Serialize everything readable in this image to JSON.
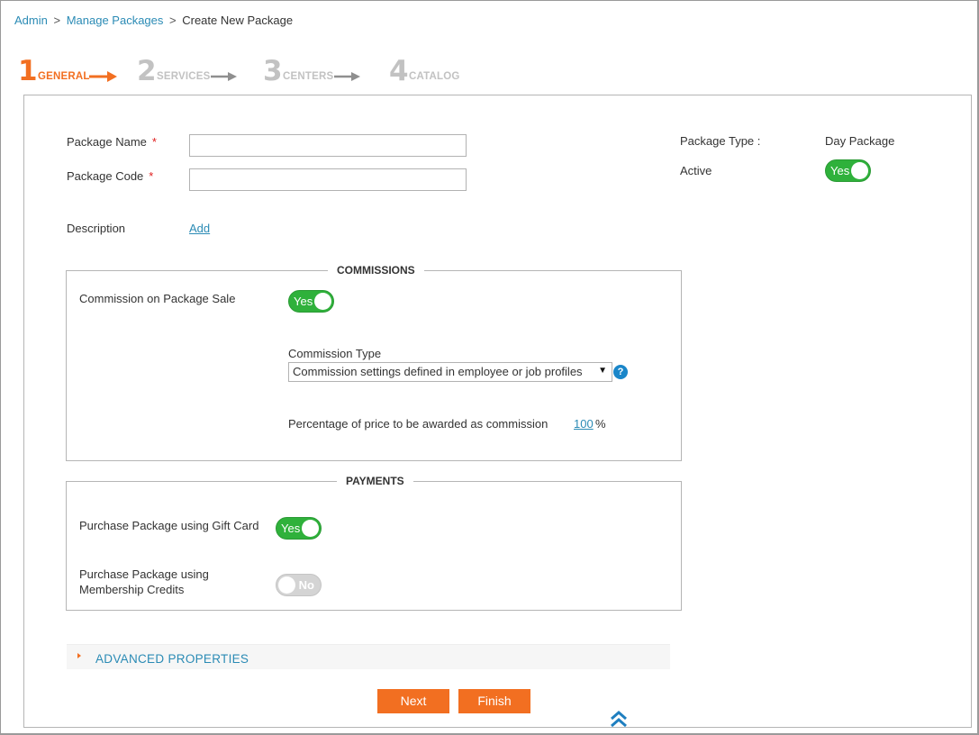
{
  "breadcrumb": {
    "admin": "Admin",
    "sep1": ">",
    "manage_packages": "Manage Packages",
    "sep2": ">",
    "current": "Create New Package"
  },
  "steps": [
    {
      "num": "1",
      "label": "GENERAL",
      "active": true
    },
    {
      "num": "2",
      "label": "SERVICES",
      "active": false
    },
    {
      "num": "3",
      "label": "CENTERS",
      "active": false
    },
    {
      "num": "4",
      "label": "CATALOG",
      "active": false
    }
  ],
  "form": {
    "package_name_label": "Package Name",
    "package_name_value": "",
    "package_code_label": "Package Code",
    "package_code_value": "",
    "required_mark": "*",
    "description_label": "Description",
    "description_add": "Add",
    "package_type_label": "Package Type :",
    "package_type_value": "Day Package",
    "active_label": "Active",
    "active_toggle": "Yes"
  },
  "commissions": {
    "title": "COMMISSIONS",
    "on_sale_label": "Commission on Package Sale",
    "on_sale_toggle": "Yes",
    "type_label": "Commission Type",
    "type_selected": "Commission settings defined in employee or job profiles",
    "help_icon": "?",
    "percentage_label": "Percentage of price to be awarded as commission",
    "percentage_value": "100",
    "percentage_unit": "%"
  },
  "payments": {
    "title": "PAYMENTS",
    "gift_card_label": "Purchase Package using Gift Card",
    "gift_card_toggle": "Yes",
    "membership_label_line1": "Purchase Package using",
    "membership_label_line2": "Membership Credits",
    "membership_toggle": "No"
  },
  "advanced": {
    "label": "ADVANCED PROPERTIES"
  },
  "buttons": {
    "next": "Next",
    "finish": "Finish"
  },
  "colors": {
    "accent": "#f26f21",
    "link": "#2b8bb5",
    "toggle_on": "#2fb13b",
    "toggle_off": "#d4d4d4"
  }
}
